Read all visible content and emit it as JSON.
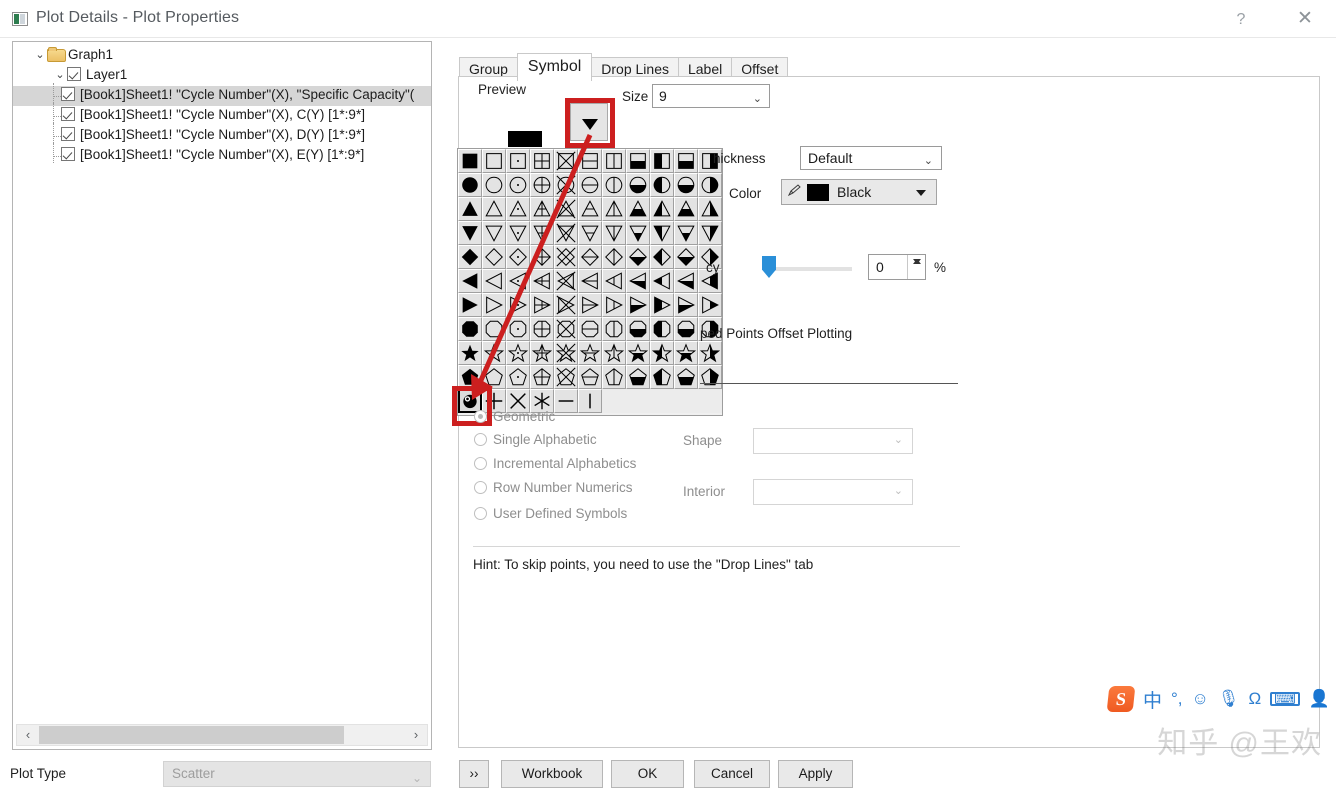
{
  "window": {
    "title": "Plot Details - Plot Properties",
    "app_icon": "plot-details-icon",
    "help_label": "?",
    "close_label": "✕"
  },
  "tree": {
    "root": {
      "label": "Graph1",
      "twisty": "⌄",
      "icon": "folder-icon"
    },
    "layer": {
      "label": "Layer1",
      "twisty": "⌄",
      "checked": true
    },
    "plots": [
      {
        "label": "[Book1]Sheet1! \"Cycle Number\"(X), \"Specific Capacity\"(",
        "checked": true,
        "selected": true
      },
      {
        "label": "[Book1]Sheet1! \"Cycle Number\"(X), C(Y) [1*:9*]",
        "checked": true,
        "selected": false
      },
      {
        "label": "[Book1]Sheet1! \"Cycle Number\"(X), D(Y) [1*:9*]",
        "checked": true,
        "selected": false
      },
      {
        "label": "[Book1]Sheet1! \"Cycle Number\"(X), E(Y) [1*:9*]",
        "checked": true,
        "selected": false
      }
    ],
    "hscroll": {
      "left_arrow": "‹",
      "right_arrow": "›"
    }
  },
  "plot_type": {
    "label": "Plot Type",
    "value": "Scatter",
    "chevron": "⌄",
    "disabled": true
  },
  "tabs": [
    {
      "label": "Group",
      "active": false
    },
    {
      "label": "Symbol",
      "active": true
    },
    {
      "label": "Drop Lines",
      "active": false
    },
    {
      "label": "Label",
      "active": false
    },
    {
      "label": "Offset",
      "active": false
    }
  ],
  "symbol_panel": {
    "preview_label": "Preview",
    "preview_swatch_color": "#000000",
    "size_label": "Size",
    "size_value": "9",
    "size_chevron": "⌄",
    "dropdown_button": {
      "name": "symbol-dropdown-button",
      "glyph": "▼"
    },
    "edge_thickness_label": "hickness",
    "edge_thickness_value": "Default",
    "edge_thickness_chevron": "⌄",
    "color_label": "Color",
    "color_value": "Black",
    "color_swatch": "#000000",
    "color_pen_icon": "pen-icon",
    "transparency_label": "cy",
    "transparency_value": "0",
    "transparency_unit": "%",
    "transparency_percent": 0,
    "overlap_label": "ped Points Offset Plotting",
    "radios": [
      {
        "label": "Geometric",
        "selected": true
      },
      {
        "label": "Single Alphabetic",
        "selected": false
      },
      {
        "label": "Incremental Alphabetics",
        "selected": false
      },
      {
        "label": "Row Number Numerics",
        "selected": false
      },
      {
        "label": "User Defined Symbols",
        "selected": false
      }
    ],
    "shape_label": "Shape",
    "shape_value": "",
    "shape_chevron": "⌄",
    "interior_label": "Interior",
    "interior_value": "",
    "interior_chevron": "⌄",
    "hint": "Hint: To skip points, you need to use the \"Drop Lines\" tab",
    "grid": {
      "columns": 11,
      "rows": 11,
      "selected_index": {
        "row": 10,
        "col": 0
      },
      "row_shapes": [
        "square",
        "circle",
        "triangle-up",
        "triangle-down",
        "diamond",
        "triangle-left",
        "triangle-right",
        "octagon",
        "star",
        "pentagon",
        "special"
      ],
      "fill_styles": [
        "solid",
        "open",
        "dot",
        "cross-quad",
        "x-cross",
        "half-horiz-line",
        "half-vert-line",
        "bottom-half",
        "left-half",
        "bottom-half2",
        "right-half"
      ],
      "special_row": [
        "ball",
        "plus",
        "x",
        "asterisk",
        "dash",
        "bar",
        "",
        "",
        "",
        "",
        ""
      ]
    }
  },
  "buttons": {
    "more": "››",
    "workbook": "Workbook",
    "ok": "OK",
    "cancel": "Cancel",
    "apply": "Apply"
  },
  "ime": {
    "logo": "S",
    "mode": "中",
    "punct": "°,",
    "emoji": "☺",
    "mic": "🎙",
    "omega": "Ω",
    "keyboard": "⌨",
    "user": "👤"
  },
  "watermark": "知乎 @王欢"
}
